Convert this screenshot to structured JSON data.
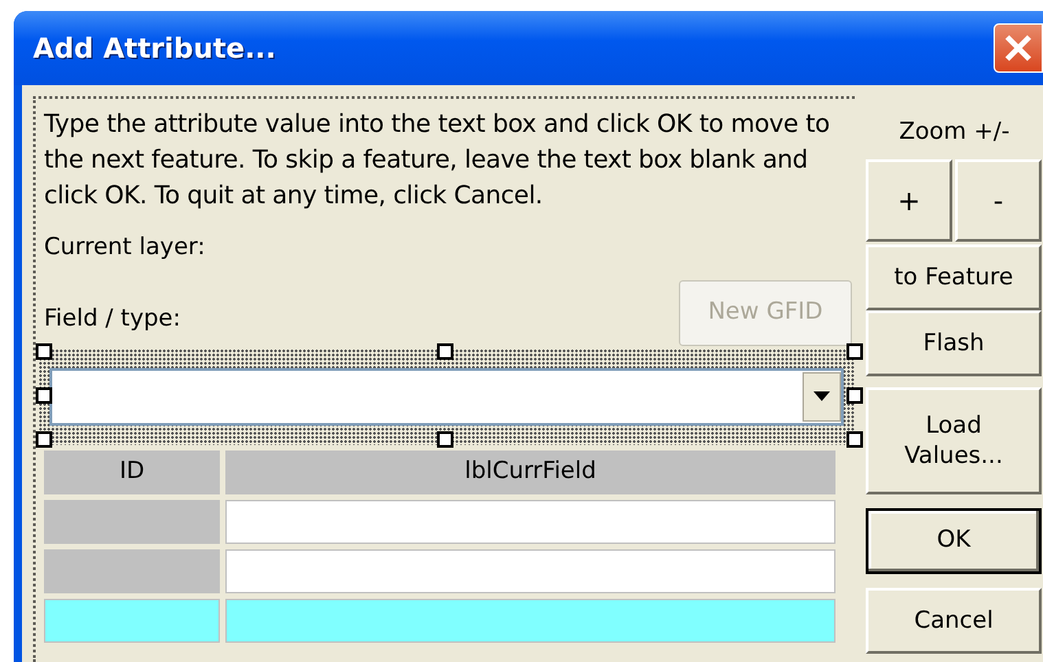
{
  "window": {
    "title": "Add Attribute..."
  },
  "instructions": "Type the attribute value into the text box and click OK to move to the next feature. To skip a feature, leave the text box blank and click OK. To quit at any time, click Cancel.",
  "current_layer_label": "Current layer:",
  "field_type_label": "Field / type:",
  "new_gfid_button": {
    "label": "New GFID",
    "disabled": true
  },
  "field_combo": {
    "selected": true
  },
  "grid": {
    "columns": [
      "ID",
      "lblCurrField"
    ],
    "rows": [
      {
        "selected": false
      },
      {
        "selected": false
      },
      {
        "selected": true
      }
    ]
  },
  "zoom": {
    "label": "Zoom +/-",
    "buttons": [
      "+",
      "-"
    ]
  },
  "side_buttons": [
    {
      "label": "to Feature",
      "default": false
    },
    {
      "label": "Flash",
      "default": false
    },
    {
      "label": "Load Values...",
      "default": false
    },
    {
      "label": "OK",
      "default": true
    },
    {
      "label": "Cancel",
      "default": false
    }
  ]
}
